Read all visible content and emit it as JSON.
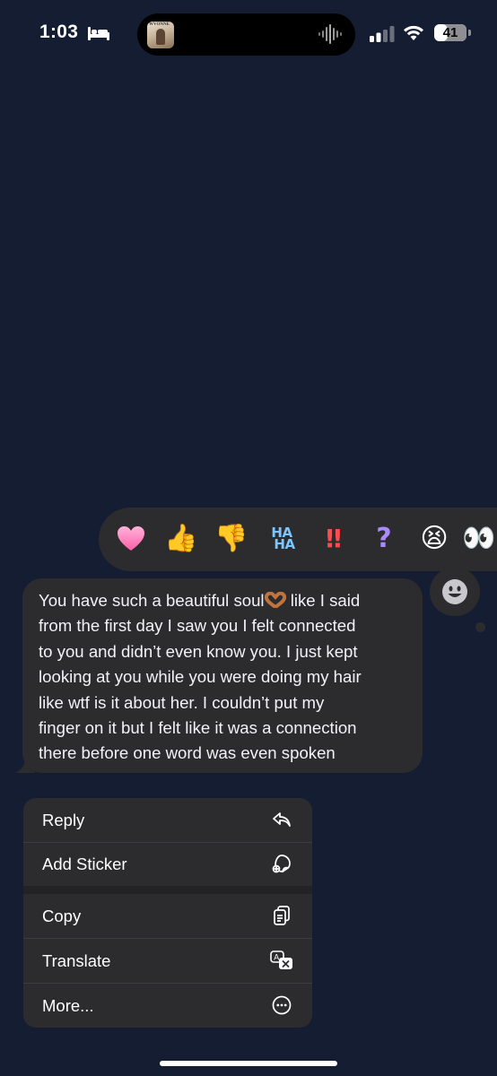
{
  "status_bar": {
    "time": "1:03",
    "battery": "41",
    "battery_level_percent": 41,
    "icons": [
      "bed-icon",
      "signal-icon",
      "wifi-icon",
      "battery-icon"
    ]
  },
  "dynamic_island": {
    "album_art_text": "WVONNE",
    "icons": [
      "album-art",
      "waveform-icon"
    ]
  },
  "reactions": [
    {
      "name": "heart",
      "glyph": "heart-icon"
    },
    {
      "name": "thumbs-up",
      "glyph": "👍"
    },
    {
      "name": "thumbs-down",
      "glyph": "👎"
    },
    {
      "name": "haha",
      "line1": "HA",
      "line2": "HA"
    },
    {
      "name": "emphasize",
      "glyph": "!!"
    },
    {
      "name": "question",
      "glyph": "?"
    },
    {
      "name": "crying",
      "glyph": "😫"
    },
    {
      "name": "eyes",
      "glyph": "👀"
    }
  ],
  "emoji_picker_icon": "smiley-icon",
  "message": {
    "lines": [
      "You have such a beautiful soul",
      " like I said",
      "from the first day I saw you I felt connected",
      "to you and didn’t even know you. I just kept",
      "looking at you while you were doing my hair",
      "like wtf is it about her. I couldn’t put my",
      "finger on it but I felt like it was a connection",
      "there before one word was even spoken"
    ],
    "inline_emoji": "heart-hands-icon"
  },
  "menu": {
    "items": [
      {
        "label": "Reply",
        "icon": "reply-icon"
      },
      {
        "label": "Add Sticker",
        "icon": "sticker-icon"
      },
      {
        "label": "Copy",
        "icon": "copy-icon"
      },
      {
        "label": "Translate",
        "icon": "translate-icon"
      },
      {
        "label": "More...",
        "icon": "more-icon"
      }
    ]
  },
  "colors": {
    "background": "#151d33",
    "bubble": "#2c2c2e",
    "haha": "#7cc6ff",
    "emphasize": "#ff4b4b",
    "question": "#a98bff"
  }
}
